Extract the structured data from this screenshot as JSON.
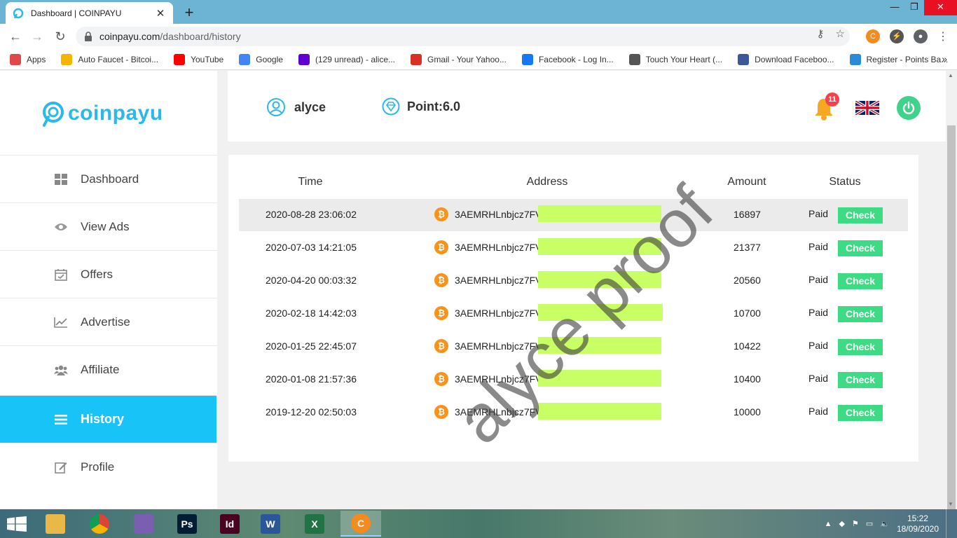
{
  "browser": {
    "tab_title": "Dashboard | COINPAYU",
    "tab_close": "✕",
    "new_tab": "+",
    "url_host": "coinpayu.com",
    "url_path": "/dashboard/history",
    "window_buttons": {
      "minimize": "—",
      "restore": "❐",
      "close": "✕"
    }
  },
  "bookmarks": [
    {
      "label": "Apps",
      "icon": "apps-grid-icon",
      "color": "#e04848"
    },
    {
      "label": "Auto Faucet - Bitcoi...",
      "icon": "autofaucet-icon",
      "color": "#f4b400"
    },
    {
      "label": "YouTube",
      "icon": "youtube-icon",
      "color": "#ff0000"
    },
    {
      "label": "Google",
      "icon": "google-icon",
      "color": "#4285f4"
    },
    {
      "label": "(129 unread) - alice...",
      "icon": "yahoo-mail-icon",
      "color": "#6001d2"
    },
    {
      "label": "Gmail - Your Yahoo...",
      "icon": "gmail-icon",
      "color": "#d93025"
    },
    {
      "label": "Facebook - Log In...",
      "icon": "facebook-icon",
      "color": "#1877f2"
    },
    {
      "label": "Touch Your Heart (...",
      "icon": "tv-icon",
      "color": "#555555"
    },
    {
      "label": "Download Faceboo...",
      "icon": "facebook-square-icon",
      "color": "#3b5998"
    },
    {
      "label": "Register - Points Ba...",
      "icon": "cart-icon",
      "color": "#2a8cd7"
    }
  ],
  "bookmarks_more": "»",
  "sidebar": {
    "logo_text": "coinpayu",
    "items": [
      {
        "label": "Dashboard",
        "icon": "dashboard-grid-icon",
        "active": false
      },
      {
        "label": "View Ads",
        "icon": "eye-icon",
        "active": false
      },
      {
        "label": "Offers",
        "icon": "calendar-check-icon",
        "active": false
      },
      {
        "label": "Advertise",
        "icon": "line-chart-icon",
        "active": false
      },
      {
        "label": "Affiliate",
        "icon": "users-icon",
        "active": false
      },
      {
        "label": "History",
        "icon": "list-icon",
        "active": true
      },
      {
        "label": "Profile",
        "icon": "edit-icon",
        "active": false
      }
    ]
  },
  "header": {
    "username": "alyce",
    "points": "Point:6.0",
    "notifications": "11"
  },
  "table": {
    "columns": [
      "Time",
      "Address",
      "Amount",
      "Status"
    ],
    "rows": [
      {
        "time": "2020-08-28 23:06:02",
        "address": "3AEMRHLnbjcz7FV",
        "amount": "16897",
        "status": "Paid",
        "action": "Check"
      },
      {
        "time": "2020-07-03 14:21:05",
        "address": "3AEMRHLnbjcz7FV",
        "amount": "21377",
        "status": "Paid",
        "action": "Check"
      },
      {
        "time": "2020-04-20 00:03:32",
        "address": "3AEMRHLnbjcz7FV",
        "amount": "20560",
        "status": "Paid",
        "action": "Check"
      },
      {
        "time": "2020-02-18 14:42:03",
        "address": "3AEMRHLnbjcz7FV",
        "amount": "10700",
        "status": "Paid",
        "action": "Check"
      },
      {
        "time": "2020-01-25 22:45:07",
        "address": "3AEMRHLnbjcz7FV",
        "amount": "10422",
        "status": "Paid",
        "action": "Check"
      },
      {
        "time": "2020-01-08 21:57:36",
        "address": "3AEMRHLnbjcz7FV",
        "amount": "10400",
        "status": "Paid",
        "action": "Check"
      },
      {
        "time": "2019-12-20 02:50:03",
        "address": "3AEMRHLnbjcz7FV",
        "amount": "10000",
        "status": "Paid",
        "action": "Check"
      }
    ]
  },
  "watermark": "alyce proof",
  "colors": {
    "accent": "#18c4f7",
    "check": "#3ddc84",
    "bitcoin": "#f7931a",
    "redaction": "#c8ff64"
  },
  "taskbar": {
    "apps": [
      {
        "name": "file-explorer",
        "label": "",
        "color": "#e8b94a"
      },
      {
        "name": "chrome",
        "label": "",
        "color": "#ffffff"
      },
      {
        "name": "photos",
        "label": "",
        "color": "#7a5fb0"
      },
      {
        "name": "photoshop",
        "label": "Ps",
        "color": "#001d34"
      },
      {
        "name": "indesign",
        "label": "Id",
        "color": "#49021f"
      },
      {
        "name": "word",
        "label": "W",
        "color": "#2b579a"
      },
      {
        "name": "excel",
        "label": "X",
        "color": "#217346"
      },
      {
        "name": "coinpayu",
        "label": "C",
        "color": "#f58a1f"
      }
    ],
    "time": "15:22",
    "date": "18/09/2020"
  }
}
